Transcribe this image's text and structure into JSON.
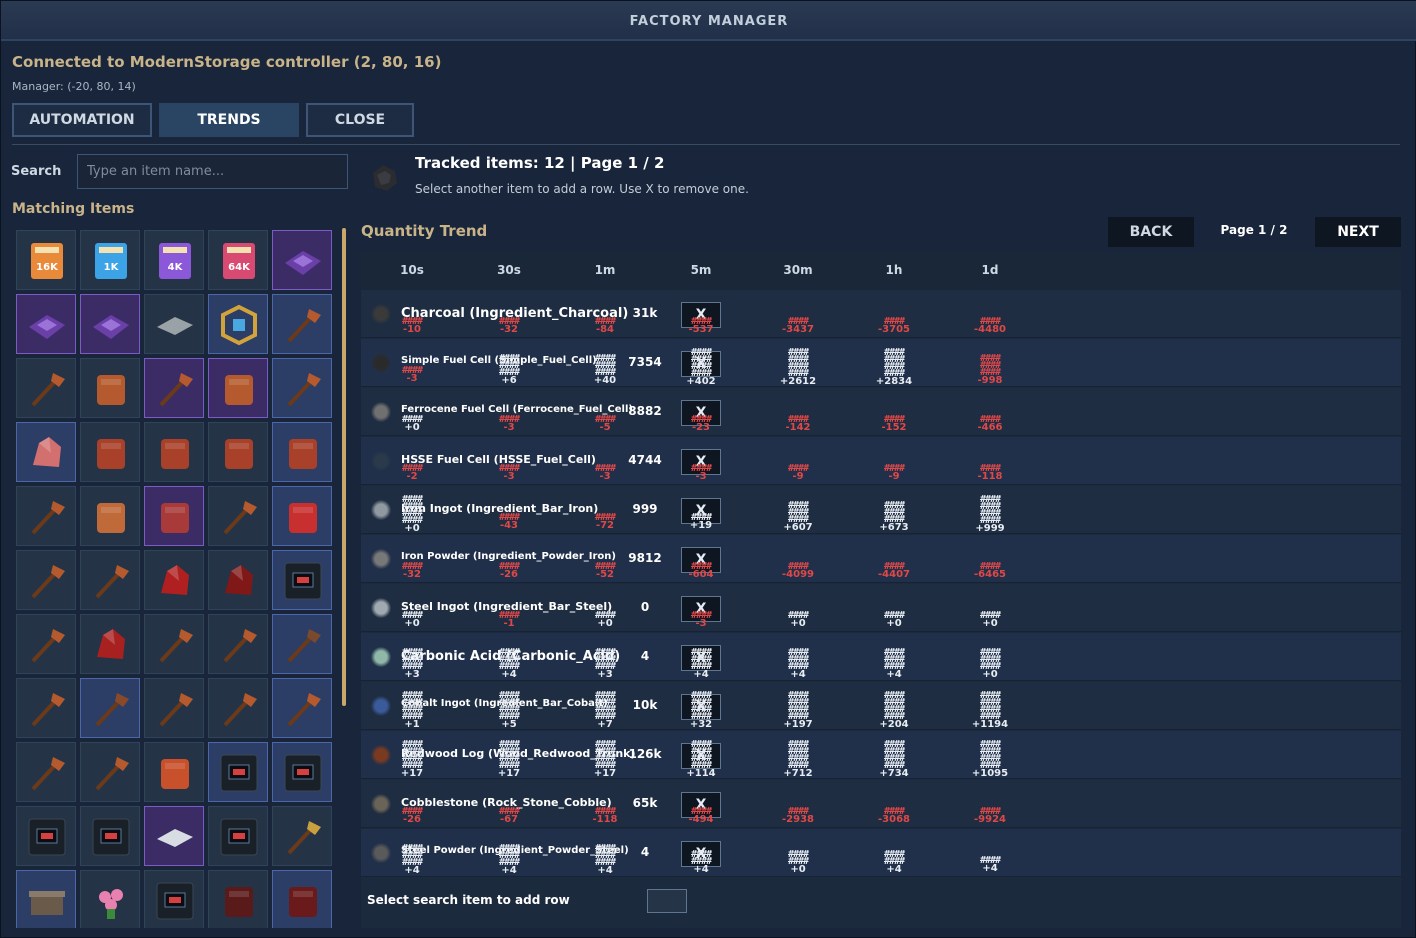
{
  "window": {
    "title": "FACTORY MANAGER"
  },
  "header": {
    "connection": "Connected to ModernStorage controller (2, 80, 16)",
    "manager": "Manager: (-20, 80, 14)"
  },
  "tabs": {
    "automation": "AUTOMATION",
    "trends": "TRENDS",
    "close": "CLOSE",
    "active": "TRENDS"
  },
  "search": {
    "label": "Search",
    "placeholder": "Type an item name..."
  },
  "matching": {
    "label": "Matching Items",
    "items": [
      {
        "name": "storage-16k",
        "label": "16K",
        "color": "#e9893a"
      },
      {
        "name": "storage-1k",
        "label": "1K",
        "color": "#3ba3e6"
      },
      {
        "name": "storage-4k",
        "label": "4K",
        "color": "#8a58d8"
      },
      {
        "name": "storage-64k",
        "label": "64K",
        "color": "#d84a72"
      },
      {
        "name": "purple-crate",
        "color": "#6a3fa8"
      },
      {
        "name": "purple-crate",
        "color": "#6a3fa8"
      },
      {
        "name": "purple-crate",
        "color": "#6a3fa8"
      },
      {
        "name": "metal-plate",
        "color": "#9aa2a8"
      },
      {
        "name": "golden-cube",
        "color": "#d2a33a"
      },
      {
        "name": "copper-weapon",
        "color": "#b55a2e"
      },
      {
        "name": "copper-hammer",
        "color": "#b55a2e"
      },
      {
        "name": "copper-armor",
        "color": "#b55a2e"
      },
      {
        "name": "copper-staff",
        "color": "#b55a2e"
      },
      {
        "name": "copper-armor",
        "color": "#b55a2e"
      },
      {
        "name": "copper-blades",
        "color": "#b55a2e"
      },
      {
        "name": "red-ore",
        "color": "#d27070"
      },
      {
        "name": "copper-block",
        "color": "#a8402a"
      },
      {
        "name": "copper-block",
        "color": "#a8402a"
      },
      {
        "name": "copper-armor",
        "color": "#a8402a"
      },
      {
        "name": "copper-armor",
        "color": "#a8402a"
      },
      {
        "name": "copper-axe",
        "color": "#b55a2e"
      },
      {
        "name": "copper-chest",
        "color": "#c06a3a"
      },
      {
        "name": "copper-chest",
        "color": "#a83a3a"
      },
      {
        "name": "copper-pick",
        "color": "#b55a2e"
      },
      {
        "name": "red-bar",
        "color": "#c83030"
      },
      {
        "name": "copper-sword",
        "color": "#b55a2e"
      },
      {
        "name": "copper-hammer",
        "color": "#b55a2e"
      },
      {
        "name": "red-crystal",
        "color": "#b02020"
      },
      {
        "name": "red-crystal",
        "color": "#801818"
      },
      {
        "name": "machine-block",
        "color": "#26323e"
      },
      {
        "name": "copper-pickaxe",
        "color": "#b55a2e"
      },
      {
        "name": "red-pile",
        "color": "#a82020"
      },
      {
        "name": "copper-blades",
        "color": "#b55a2e"
      },
      {
        "name": "copper-dagger",
        "color": "#b55a2e"
      },
      {
        "name": "copper-spear",
        "color": "#7a4a2e"
      },
      {
        "name": "copper-crossbow",
        "color": "#b55a2e"
      },
      {
        "name": "copper-bow",
        "color": "#8a4a2a"
      },
      {
        "name": "copper-sickle",
        "color": "#b55a2e"
      },
      {
        "name": "copper-spear",
        "color": "#b55a2e"
      },
      {
        "name": "copper-spear",
        "color": "#b55a2e"
      },
      {
        "name": "copper-wand",
        "color": "#b55a2e"
      },
      {
        "name": "copper-sword",
        "color": "#b55a2e"
      },
      {
        "name": "copper-helmet",
        "color": "#c8502a"
      },
      {
        "name": "machine-block",
        "color": "#26323e"
      },
      {
        "name": "machine-block",
        "color": "#26323e"
      },
      {
        "name": "machine-block",
        "color": "#26323e"
      },
      {
        "name": "machine-block",
        "color": "#26323e"
      },
      {
        "name": "white-cloth",
        "color": "#d8dde4"
      },
      {
        "name": "machine-block",
        "color": "#26323e"
      },
      {
        "name": "golden-crossbow",
        "color": "#c8a040"
      },
      {
        "name": "workbench",
        "color": "#6a5a4a"
      },
      {
        "name": "pink-flowers",
        "color": "#e880b0"
      },
      {
        "name": "machine-block",
        "color": "#26323e"
      },
      {
        "name": "dark-red-block",
        "color": "#5a1a1a"
      },
      {
        "name": "dark-red-block",
        "color": "#6a1a1a"
      }
    ]
  },
  "tracked": {
    "summary": "Tracked items: 12 | Page 1 / 2",
    "hint": "Select another item to add a row. Use X to remove one."
  },
  "trend": {
    "label": "Quantity Trend",
    "back": "BACK",
    "page": "Page 1 / 2",
    "next": "NEXT",
    "columns": [
      "10s",
      "30s",
      "1m",
      "5m",
      "30m",
      "1h",
      "1d"
    ],
    "remove_label": "X",
    "rows": [
      {
        "name": "Charcoal (Ingredient_Charcoal)",
        "qty": "31k",
        "icon": "#3a3a3a",
        "deltas": [
          "-10",
          "-32",
          "-84",
          "-537",
          "-3437",
          "-3705",
          "-4480"
        ],
        "levels": [
          1,
          1,
          1,
          1,
          1,
          1,
          1
        ]
      },
      {
        "name": "Simple Fuel Cell (Simple_Fuel_Cell)",
        "qty": "7354",
        "icon": "#2a2a2a",
        "deltas": [
          "-3",
          "+6",
          "+40",
          "+402",
          "+2612",
          "+2834",
          "-998"
        ],
        "levels": [
          1,
          3,
          3,
          4,
          4,
          4,
          3
        ]
      },
      {
        "name": "Ferrocene Fuel Cell (Ferrocene_Fuel_Cell)",
        "qty": "8882",
        "icon": "#707070",
        "deltas": [
          "+0",
          "-3",
          "-5",
          "-23",
          "-142",
          "-152",
          "-466"
        ],
        "levels": [
          1,
          1,
          1,
          1,
          1,
          1,
          1
        ]
      },
      {
        "name": "HSSE Fuel Cell (HSSE_Fuel_Cell)",
        "qty": "4744",
        "icon": "#2a3a4a",
        "deltas": [
          "-2",
          "-3",
          "-3",
          "-3",
          "-9",
          "-9",
          "-118"
        ],
        "levels": [
          1,
          1,
          1,
          1,
          1,
          1,
          1
        ]
      },
      {
        "name": "Iron Ingot (Ingredient_Bar_Iron)",
        "qty": "999",
        "icon": "#9098a0",
        "deltas": [
          "+0",
          "-43",
          "-72",
          "+19",
          "+607",
          "+673",
          "+999"
        ],
        "levels": [
          4,
          1,
          1,
          1,
          3,
          3,
          4
        ]
      },
      {
        "name": "Iron Powder (Ingredient_Powder_Iron)",
        "qty": "9812",
        "icon": "#787878",
        "deltas": [
          "-32",
          "-26",
          "-52",
          "-604",
          "-4099",
          "-4407",
          "-6465"
        ],
        "levels": [
          1,
          1,
          1,
          1,
          1,
          1,
          1
        ]
      },
      {
        "name": "Steel Ingot (Ingredient_Bar_Steel)",
        "qty": "0",
        "icon": "#a0a8b0",
        "deltas": [
          "+0",
          "-1",
          "+0",
          "-3",
          "+0",
          "+0",
          "+0"
        ],
        "levels": [
          1,
          1,
          1,
          1,
          1,
          1,
          1
        ]
      },
      {
        "name": "Carbonic Acid (Carbonic_Acid)",
        "qty": "4",
        "icon": "#8fb8a8",
        "deltas": [
          "+3",
          "+4",
          "+3",
          "+4",
          "+4",
          "+4",
          "+0"
        ],
        "levels": [
          3,
          3,
          3,
          3,
          3,
          3,
          3
        ]
      },
      {
        "name": "Cobalt Ingot (Ingredient_Bar_Cobalt)",
        "qty": "10k",
        "icon": "#3a5a9a",
        "deltas": [
          "+1",
          "+5",
          "+7",
          "+32",
          "+197",
          "+204",
          "+1194"
        ],
        "levels": [
          4,
          4,
          4,
          4,
          4,
          4,
          4
        ]
      },
      {
        "name": "Redwood Log (Wood_Redwood_Trunk)",
        "qty": "126k",
        "icon": "#7a3a20",
        "deltas": [
          "+17",
          "+17",
          "+17",
          "+114",
          "+712",
          "+734",
          "+1095"
        ],
        "levels": [
          4,
          4,
          4,
          4,
          4,
          4,
          4
        ]
      },
      {
        "name": "Cobblestone (Rock_Stone_Cobble)",
        "qty": "65k",
        "icon": "#6a6458",
        "deltas": [
          "-26",
          "-67",
          "-118",
          "-494",
          "-2938",
          "-3068",
          "-9924"
        ],
        "levels": [
          1,
          1,
          1,
          1,
          1,
          1,
          1
        ]
      },
      {
        "name": "Steel Powder (Ingredient_Powder_Steel)",
        "qty": "4",
        "icon": "#5a5a5a",
        "deltas": [
          "+4",
          "+4",
          "+4",
          "+4",
          "+0",
          "+4",
          "+4"
        ],
        "levels": [
          3,
          3,
          3,
          2,
          2,
          2,
          1
        ]
      }
    ],
    "footer_label": "Select search item to add row"
  }
}
